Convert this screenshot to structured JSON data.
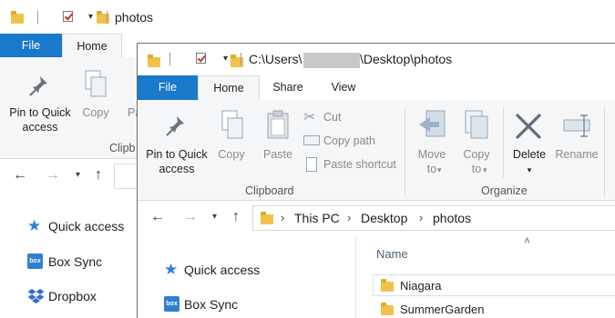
{
  "back_window": {
    "title": "photos",
    "tabs": {
      "file": "File",
      "home": "Home"
    },
    "ribbon": {
      "pin_label": "Pin to Quick access",
      "copy_label": "Copy",
      "paste_partial": "Pa",
      "clipboard_partial": "Clipb"
    },
    "nav_items": [
      {
        "label": "Quick access",
        "icon": "star-icon"
      },
      {
        "label": "Box Sync",
        "icon": "box-icon"
      },
      {
        "label": "Dropbox",
        "icon": "dropbox-icon"
      }
    ]
  },
  "front_window": {
    "title": "C:\\Users\\",
    "title_tail": "\\Desktop\\photos",
    "tabs": {
      "file": "File",
      "home": "Home",
      "share": "Share",
      "view": "View"
    },
    "ribbon": {
      "pin_label": "Pin to Quick access",
      "copy_label": "Copy",
      "paste_label": "Paste",
      "cut_label": "Cut",
      "copy_path_label": "Copy path",
      "paste_shortcut_label": "Paste shortcut",
      "clipboard_group": "Clipboard",
      "move_to_label": "Move to",
      "copy_to_label": "Copy to",
      "delete_label": "Delete",
      "rename_label": "Rename",
      "organize_group": "Organize"
    },
    "breadcrumb": [
      "This PC",
      "Desktop",
      "photos"
    ],
    "nav_items": [
      {
        "label": "Quick access",
        "icon": "star-icon"
      },
      {
        "label": "Box Sync",
        "icon": "box-icon"
      }
    ],
    "column_header": "Name",
    "files": [
      {
        "name": "Niagara"
      },
      {
        "name": "SummerGarden"
      }
    ]
  },
  "colors": {
    "accent": "#1979ca",
    "folder": "#f1c24b",
    "ribbon_bg": "#f5f6f7"
  }
}
